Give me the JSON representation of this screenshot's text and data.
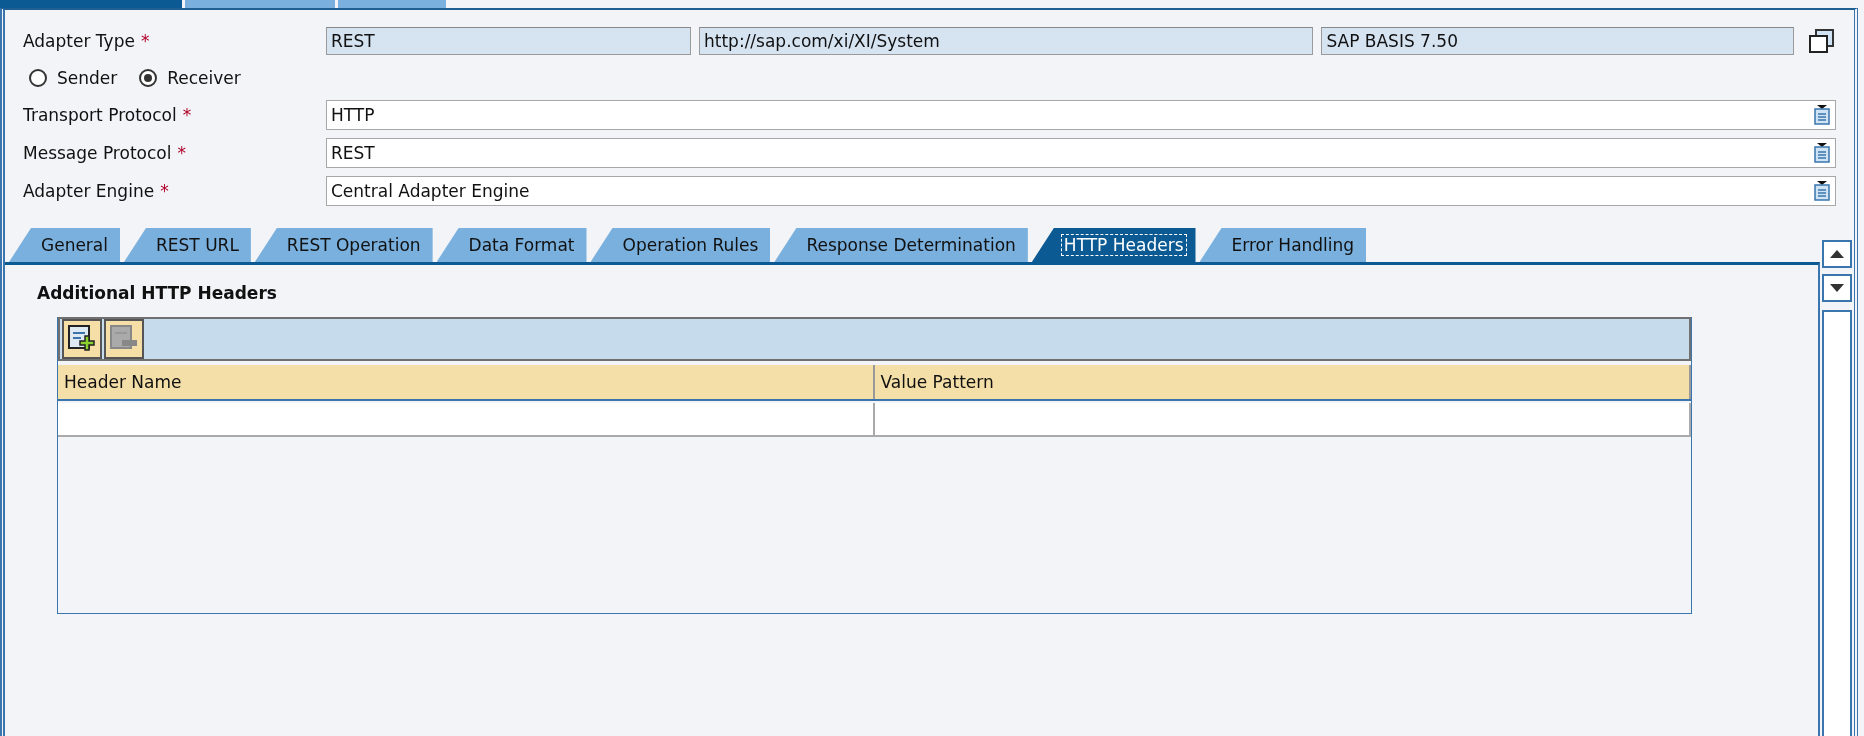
{
  "adapter_type": {
    "label": "Adapter Type",
    "required_mark": "*",
    "values": [
      "REST",
      "http://sap.com/xi/XI/System",
      "SAP BASIS 7.50"
    ]
  },
  "direction": [
    {
      "label": "Sender",
      "selected": false
    },
    {
      "label": "Receiver",
      "selected": true
    }
  ],
  "fields": [
    {
      "label": "Transport Protocol",
      "required_mark": "*",
      "value": "HTTP"
    },
    {
      "label": "Message Protocol",
      "required_mark": "*",
      "value": "REST"
    },
    {
      "label": "Adapter Engine",
      "required_mark": "*",
      "value": "Central Adapter Engine"
    }
  ],
  "tabs": [
    {
      "label": "General",
      "selected": false
    },
    {
      "label": "REST URL",
      "selected": false
    },
    {
      "label": "REST Operation",
      "selected": false
    },
    {
      "label": "Data Format",
      "selected": false
    },
    {
      "label": "Operation Rules",
      "selected": false
    },
    {
      "label": "Response Determination",
      "selected": false
    },
    {
      "label": "HTTP Headers",
      "selected": true
    },
    {
      "label": "Error Handling",
      "selected": false
    }
  ],
  "section_title": "Additional HTTP Headers",
  "table": {
    "toolbar": [
      {
        "kind": "add",
        "disabled": false
      },
      {
        "kind": "remove",
        "disabled": true
      }
    ],
    "columns": [
      "Header Name",
      "Value Pattern"
    ]
  }
}
